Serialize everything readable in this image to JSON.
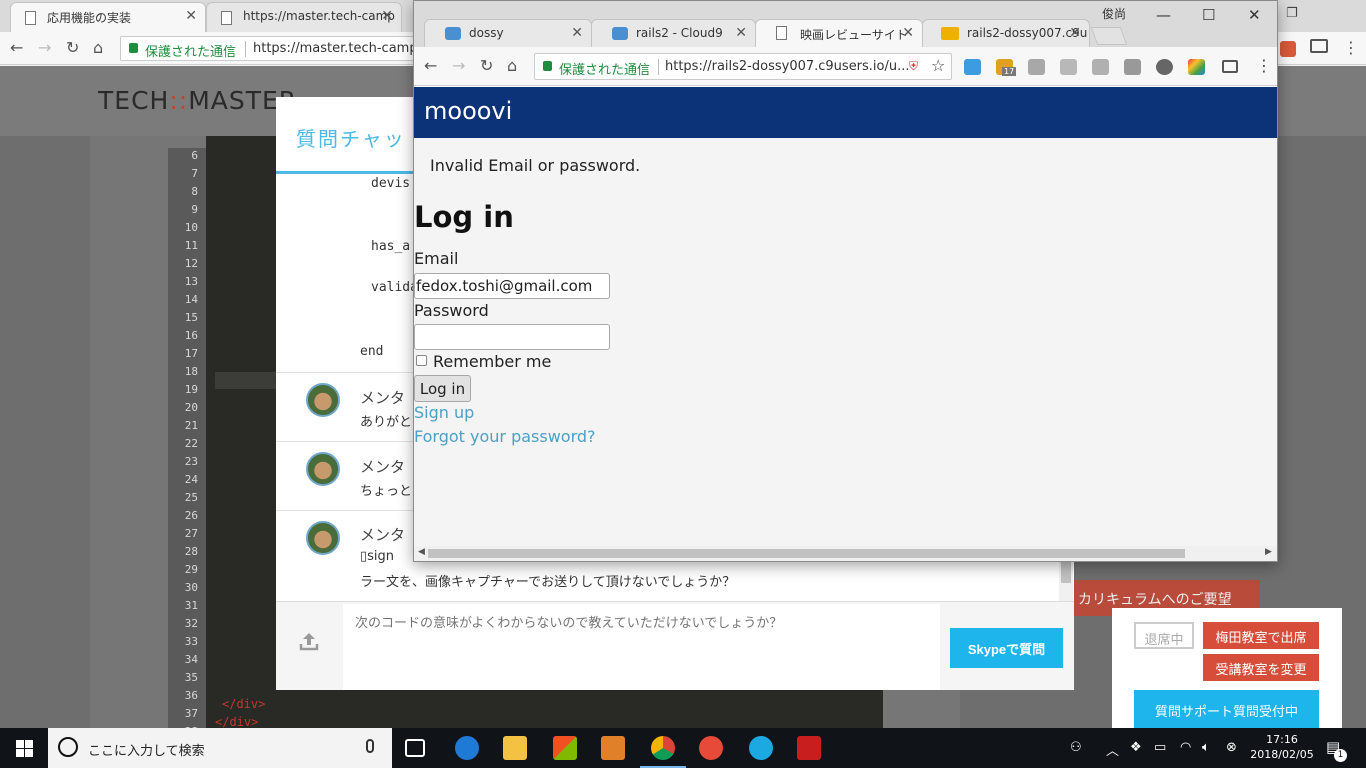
{
  "bg_browser": {
    "tabs": [
      {
        "title": "応用機能の実装",
        "close": "✕"
      },
      {
        "title": "https://master.tech-camp",
        "close": "✕"
      }
    ],
    "secure_label": "保護された通信",
    "url": "https://master.tech-camp."
  },
  "bg_page": {
    "logo_left": "TECH",
    "logo_colons": "::",
    "logo_right": "MASTER",
    "line_numbers": [
      "6",
      "7",
      "8",
      "9",
      "10",
      "11",
      "12",
      "13",
      "14",
      "15",
      "16",
      "17",
      "18",
      "19",
      "20",
      "21",
      "22",
      "23",
      "24",
      "25",
      "26",
      "27",
      "28",
      "29",
      "30",
      "31",
      "32",
      "33",
      "34",
      "35",
      "36",
      "37",
      "38"
    ],
    "code_tags": [
      "</div>",
      "</div>"
    ],
    "curriculum_button": "カリキュラムへのご要望"
  },
  "chat": {
    "title": "質問チャッ",
    "code_lines": [
      "devis",
      "has_a",
      "valida",
      "end"
    ],
    "messages": [
      {
        "name": "メンタ",
        "text": "ありがと"
      },
      {
        "name": "メンタ",
        "text": "ちょっと"
      },
      {
        "name": "メンタ",
        "text": "▯sign",
        "text2": "ラー文を、画像キャプチャーでお送りして頂けないでしょうか？"
      }
    ],
    "input_placeholder": "次のコードの意味がよくわからないので教えていただけないでしょうか？",
    "skype_button": "Skypeで質問"
  },
  "attendance": {
    "absent": "退席中",
    "umeda": "梅田教室で出席",
    "change": "受講教室を変更",
    "support": "質問サポート質問受付中"
  },
  "fg_browser": {
    "user": "俊尚",
    "tabs": [
      {
        "title": "dossy",
        "close": "✕"
      },
      {
        "title": "rails2 - Cloud9",
        "close": "✕"
      },
      {
        "title": "映画レビューサイト",
        "close": "✕"
      },
      {
        "title": "rails2-dossy007.c9u",
        "close": "✕"
      }
    ],
    "secure_label": "保護された通信",
    "url": "https://rails2-dossy007.c9users.io/u...",
    "ext_badge": "17"
  },
  "app": {
    "brand": "mooovi",
    "flash": "Invalid Email or password.",
    "heading": "Log in",
    "email_label": "Email",
    "email_value": "fedox.toshi@gmail.com",
    "password_label": "Password",
    "password_value": "",
    "remember_label": "Remember me",
    "login_button": "Log in",
    "signup_link": "Sign up",
    "forgot_link": "Forgot your password?"
  },
  "taskbar": {
    "search_placeholder": "ここに入力して検索",
    "time": "17:16",
    "date": "2018/02/05",
    "notifications": "1"
  }
}
